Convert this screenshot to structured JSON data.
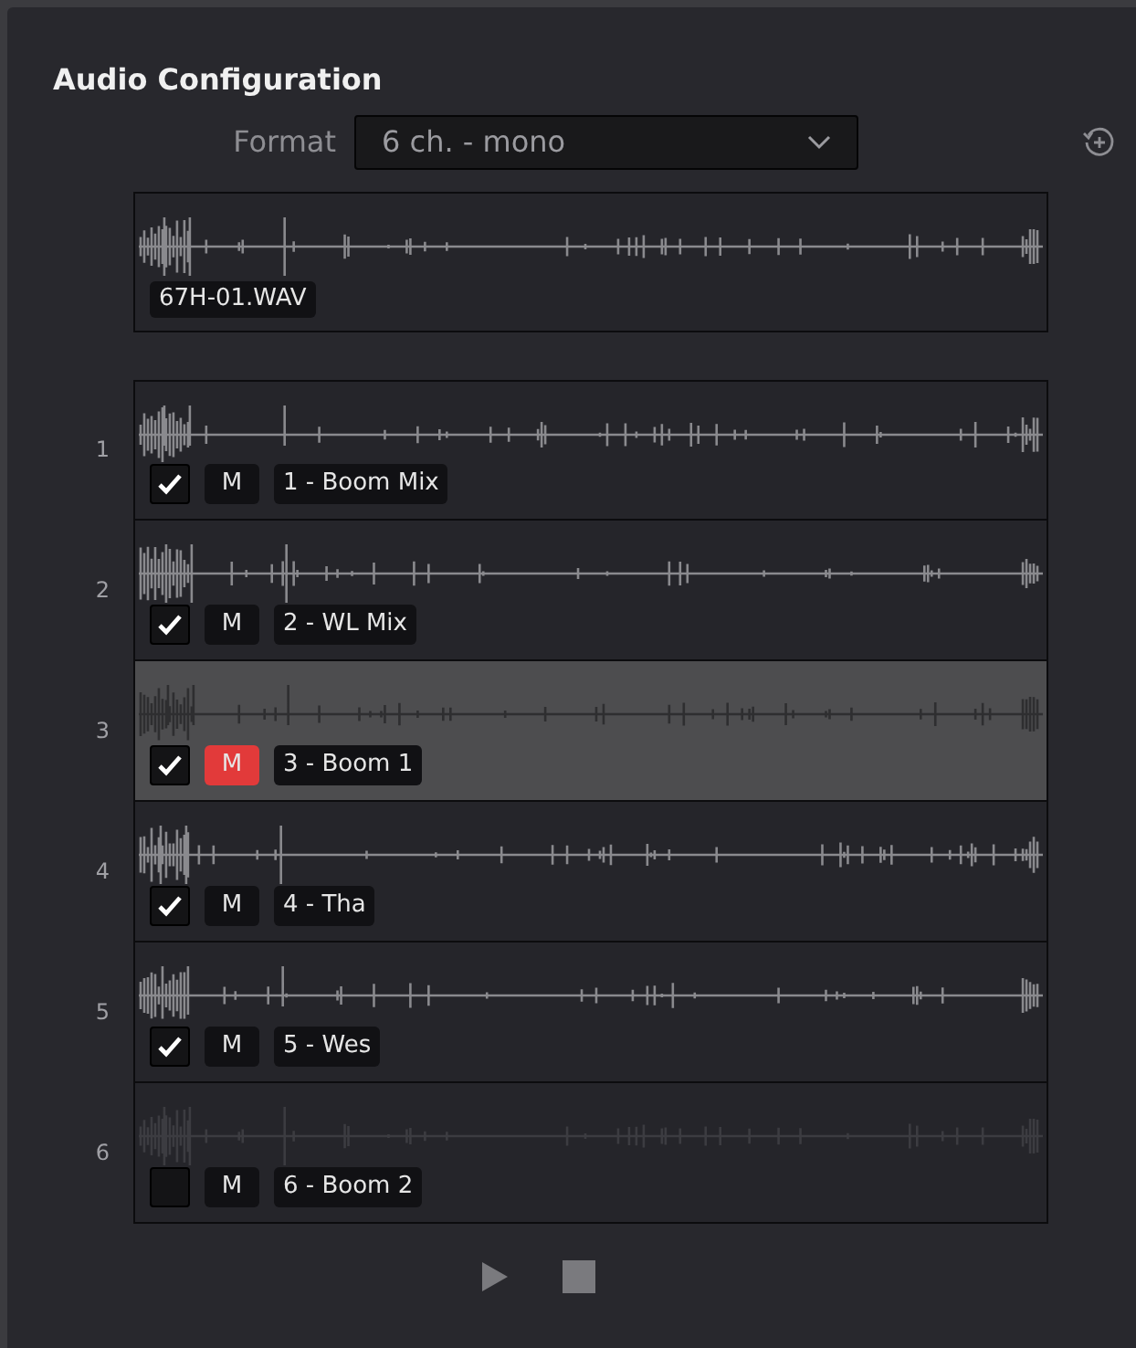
{
  "panel": {
    "title": "Audio Configuration"
  },
  "format": {
    "label": "Format",
    "value": "6 ch. - mono"
  },
  "source": {
    "name": "67H-01.WAV"
  },
  "tracks": [
    {
      "number": "1",
      "name": "1 - Boom Mix",
      "checked": true,
      "mute_label": "M",
      "muted": false,
      "selected": false
    },
    {
      "number": "2",
      "name": "2 - WL Mix",
      "checked": true,
      "mute_label": "M",
      "muted": false,
      "selected": false
    },
    {
      "number": "3",
      "name": "3 - Boom 1",
      "checked": true,
      "mute_label": "M",
      "muted": true,
      "selected": true
    },
    {
      "number": "4",
      "name": "4 - Tha",
      "checked": true,
      "mute_label": "M",
      "muted": false,
      "selected": false
    },
    {
      "number": "5",
      "name": "5 - Wes",
      "checked": true,
      "mute_label": "M",
      "muted": false,
      "selected": false
    },
    {
      "number": "6",
      "name": "6 - Boom 2",
      "checked": false,
      "mute_label": "M",
      "muted": false,
      "selected": false
    }
  ]
}
